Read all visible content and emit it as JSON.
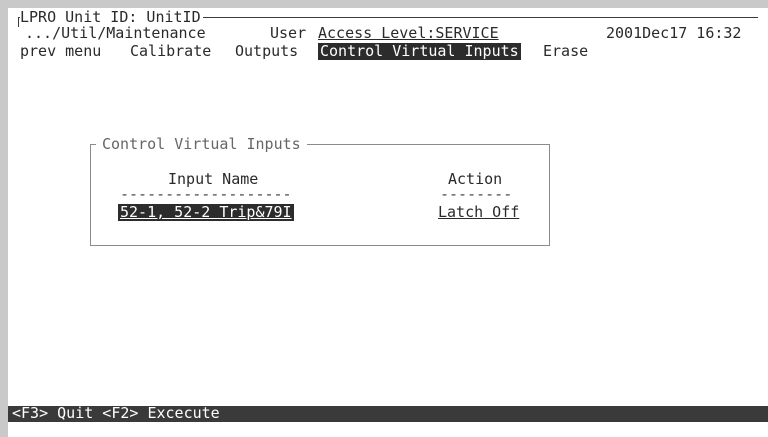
{
  "header": {
    "unit_line": "LPRO Unit ID: UnitID",
    "path": ".../Util/Maintenance",
    "user_label": "User",
    "access_level": "Access Level:SERVICE",
    "datetime": "2001Dec17 16:32"
  },
  "menu": {
    "items": [
      "prev menu",
      "Calibrate",
      "Outputs",
      "Control Virtual Inputs",
      "Erase"
    ],
    "selected": "Control Virtual Inputs"
  },
  "panel": {
    "title": "Control Virtual Inputs",
    "col_input_name": "Input Name",
    "col_action": "Action",
    "input_name_dashes": "-------------------",
    "action_dashes": "--------",
    "row": {
      "input_name": "52-1, 52-2 Trip&79I",
      "action": "Latch Off"
    }
  },
  "statusbar": {
    "text": "<F3> Quit <F2> Excecute"
  }
}
